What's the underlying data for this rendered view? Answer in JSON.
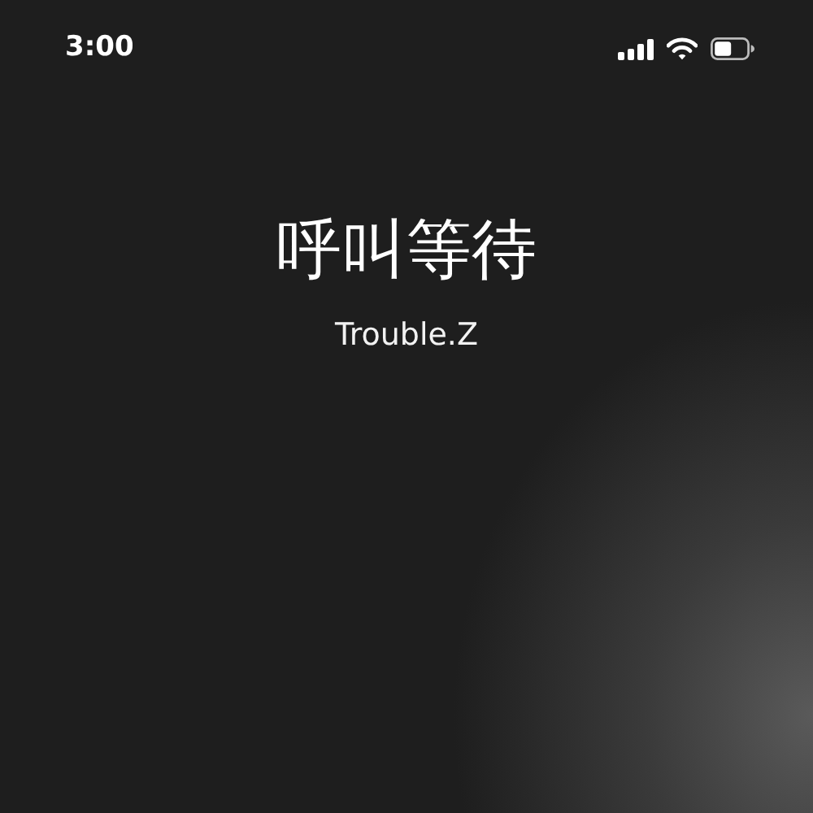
{
  "status_bar": {
    "time": "3:00"
  },
  "call": {
    "status": "呼叫等待",
    "name": "Trouble.Z"
  }
}
